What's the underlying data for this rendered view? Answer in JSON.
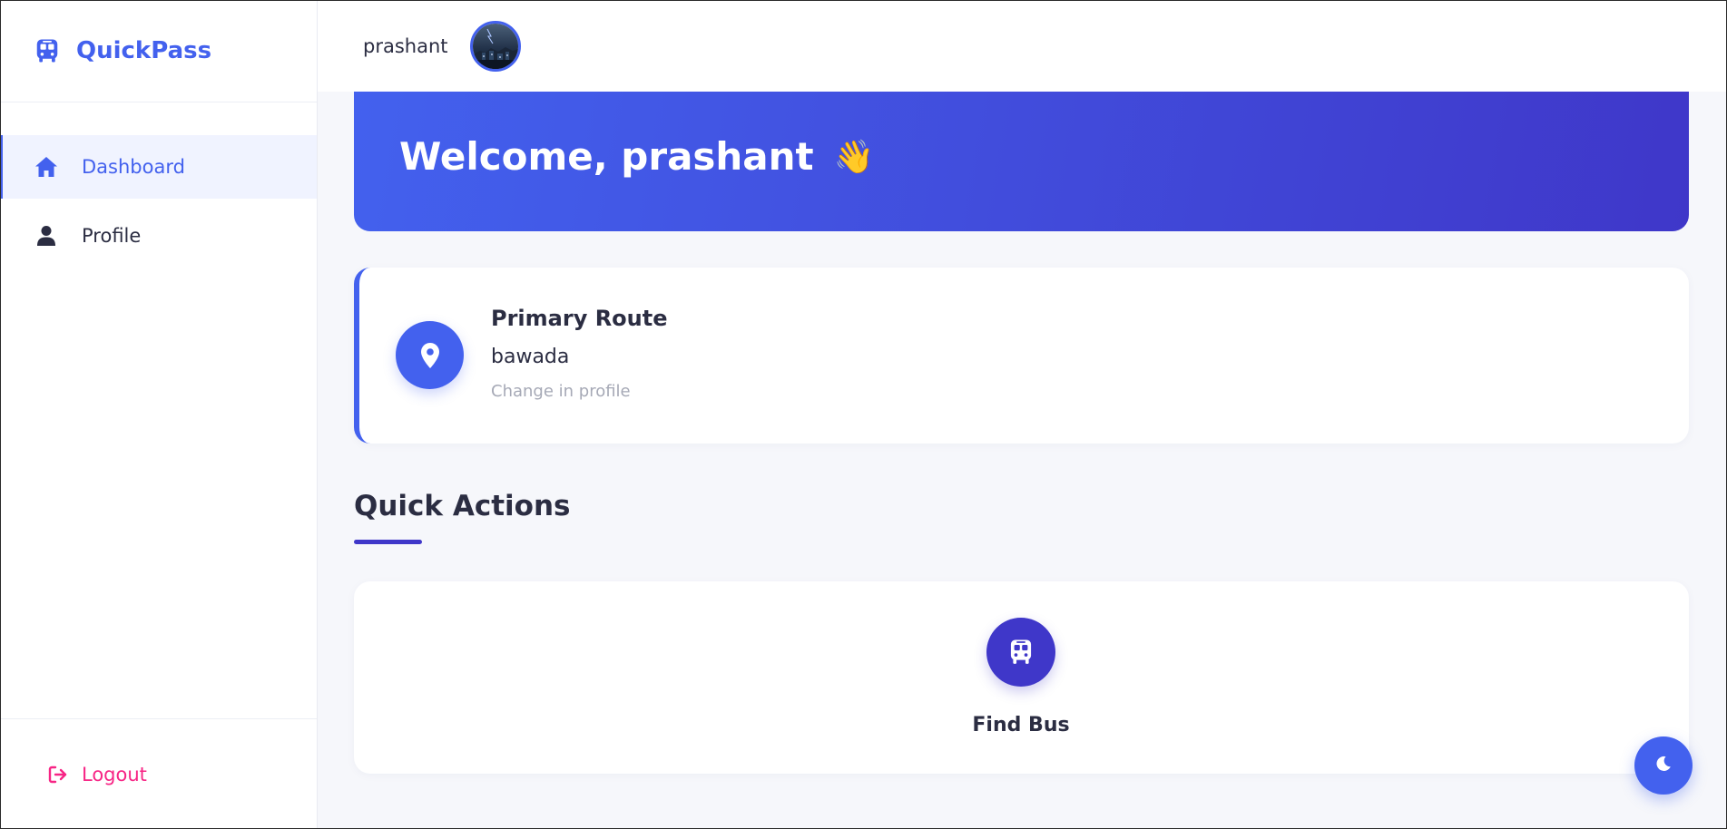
{
  "brand": {
    "name": "QuickPass",
    "icon": "bus-icon"
  },
  "sidebar": {
    "items": [
      {
        "label": "Dashboard",
        "icon": "home-icon",
        "active": true
      },
      {
        "label": "Profile",
        "icon": "user-icon",
        "active": false
      }
    ],
    "logout": {
      "label": "Logout",
      "icon": "sign-out-icon"
    }
  },
  "header": {
    "username": "prashant",
    "avatar": "avatar-image"
  },
  "welcome": {
    "text": "Welcome, prashant",
    "emoji": "👋"
  },
  "route": {
    "title": "Primary Route",
    "name": "bawada",
    "hint": "Change in profile",
    "icon": "map-pin-icon"
  },
  "quick_actions": {
    "title": "Quick Actions",
    "items": [
      {
        "label": "Find Bus",
        "icon": "bus-icon"
      }
    ]
  },
  "theme_toggle": {
    "icon": "moon-icon"
  },
  "colors": {
    "primary": "#4361ee",
    "secondary": "#3f37c9",
    "danger": "#f72585",
    "text": "#2b2d42",
    "muted": "#a6a9b6",
    "background": "#f6f7fb"
  }
}
